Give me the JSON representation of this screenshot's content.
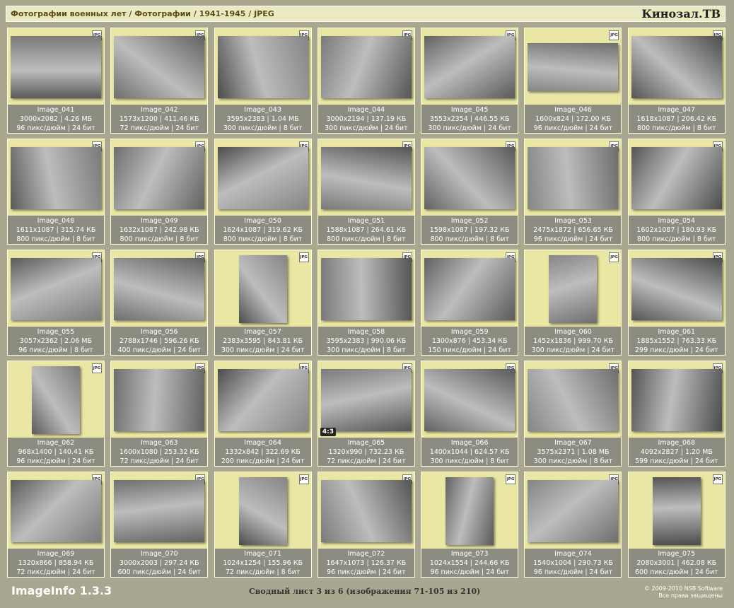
{
  "header": {
    "breadcrumb": "Фотографии военных лет / Фотографии / 1941-1945 / JPEG",
    "site": "Кинозал.ТВ"
  },
  "file_badge": "JPG",
  "images": [
    {
      "name": "Image_041",
      "dims": "3000x2082",
      "size": "4.26 МБ",
      "dpi": "96 пикс/дюйм",
      "bits": "24 бит",
      "orient": "land"
    },
    {
      "name": "Image_042",
      "dims": "1573x1200",
      "size": "411.46 КБ",
      "dpi": "72 пикс/дюйм",
      "bits": "24 бит",
      "orient": "land"
    },
    {
      "name": "Image_043",
      "dims": "3595x2383",
      "size": "1.04 МБ",
      "dpi": "300 пикс/дюйм",
      "bits": "8 бит",
      "orient": "land"
    },
    {
      "name": "Image_044",
      "dims": "3000x2194",
      "size": "137.19 КБ",
      "dpi": "300 пикс/дюйм",
      "bits": "24 бит",
      "orient": "land"
    },
    {
      "name": "Image_045",
      "dims": "3553x2354",
      "size": "446.55 КБ",
      "dpi": "300 пикс/дюйм",
      "bits": "24 бит",
      "orient": "land"
    },
    {
      "name": "Image_046",
      "dims": "1600x824",
      "size": "172.00 КБ",
      "dpi": "96 пикс/дюйм",
      "bits": "24 бит",
      "orient": "wide"
    },
    {
      "name": "Image_047",
      "dims": "1618x1087",
      "size": "206.42 КБ",
      "dpi": "800 пикс/дюйм",
      "bits": "8 бит",
      "orient": "land"
    },
    {
      "name": "Image_048",
      "dims": "1611x1087",
      "size": "315.74 КБ",
      "dpi": "800 пикс/дюйм",
      "bits": "8 бит",
      "orient": "land"
    },
    {
      "name": "Image_049",
      "dims": "1632x1087",
      "size": "242.98 КБ",
      "dpi": "800 пикс/дюйм",
      "bits": "8 бит",
      "orient": "land"
    },
    {
      "name": "Image_050",
      "dims": "1624x1087",
      "size": "319.62 КБ",
      "dpi": "800 пикс/дюйм",
      "bits": "8 бит",
      "orient": "land"
    },
    {
      "name": "Image_051",
      "dims": "1588x1087",
      "size": "264.61 КБ",
      "dpi": "800 пикс/дюйм",
      "bits": "8 бит",
      "orient": "land"
    },
    {
      "name": "Image_052",
      "dims": "1598x1087",
      "size": "197.32 КБ",
      "dpi": "800 пикс/дюйм",
      "bits": "8 бит",
      "orient": "land"
    },
    {
      "name": "Image_053",
      "dims": "2475x1872",
      "size": "656.65 КБ",
      "dpi": "96 пикс/дюйм",
      "bits": "24 бит",
      "orient": "land"
    },
    {
      "name": "Image_054",
      "dims": "1602x1087",
      "size": "180.93 КБ",
      "dpi": "800 пикс/дюйм",
      "bits": "8 бит",
      "orient": "land"
    },
    {
      "name": "Image_055",
      "dims": "3057x2362",
      "size": "2.06 МБ",
      "dpi": "96 пикс/дюйм",
      "bits": "8 бит",
      "orient": "land"
    },
    {
      "name": "Image_056",
      "dims": "2788x1746",
      "size": "596.26 КБ",
      "dpi": "400 пикс/дюйм",
      "bits": "24 бит",
      "orient": "land"
    },
    {
      "name": "Image_057",
      "dims": "2383x3595",
      "size": "843.81 КБ",
      "dpi": "300 пикс/дюйм",
      "bits": "24 бит",
      "orient": "port"
    },
    {
      "name": "Image_058",
      "dims": "3595x2383",
      "size": "990.06 КБ",
      "dpi": "300 пикс/дюйм",
      "bits": "8 бит",
      "orient": "land"
    },
    {
      "name": "Image_059",
      "dims": "1300x876",
      "size": "453.34 КБ",
      "dpi": "150 пикс/дюйм",
      "bits": "24 бит",
      "orient": "land"
    },
    {
      "name": "Image_060",
      "dims": "1452x1836",
      "size": "999.70 КБ",
      "dpi": "300 пикс/дюйм",
      "bits": "24 бит",
      "orient": "port"
    },
    {
      "name": "Image_061",
      "dims": "1885x1552",
      "size": "763.33 КБ",
      "dpi": "299 пикс/дюйм",
      "bits": "24 бит",
      "orient": "land"
    },
    {
      "name": "Image_062",
      "dims": "968x1400",
      "size": "140.41 КБ",
      "dpi": "96 пикс/дюйм",
      "bits": "24 бит",
      "orient": "port"
    },
    {
      "name": "Image_063",
      "dims": "1600x1080",
      "size": "253.32 КБ",
      "dpi": "72 пикс/дюйм",
      "bits": "24 бит",
      "orient": "land"
    },
    {
      "name": "Image_064",
      "dims": "1332x842",
      "size": "322.69 КБ",
      "dpi": "200 пикс/дюйм",
      "bits": "24 бит",
      "orient": "land"
    },
    {
      "name": "Image_065",
      "dims": "1320x990",
      "size": "732.23 КБ",
      "dpi": "72 пикс/дюйм",
      "bits": "24 бит",
      "orient": "land",
      "badge": "4:3"
    },
    {
      "name": "Image_066",
      "dims": "1400x1044",
      "size": "624.57 КБ",
      "dpi": "300 пикс/дюйм",
      "bits": "8 бит",
      "orient": "land"
    },
    {
      "name": "Image_067",
      "dims": "3575x2371",
      "size": "1.08 МБ",
      "dpi": "300 пикс/дюйм",
      "bits": "8 бит",
      "orient": "land"
    },
    {
      "name": "Image_068",
      "dims": "4092x2827",
      "size": "1.20 МБ",
      "dpi": "599 пикс/дюйм",
      "bits": "24 бит",
      "orient": "land"
    },
    {
      "name": "Image_069",
      "dims": "1320x866",
      "size": "858.94 КБ",
      "dpi": "72 пикс/дюйм",
      "bits": "24 бит",
      "orient": "land"
    },
    {
      "name": "Image_070",
      "dims": "3000x2003",
      "size": "297.24 КБ",
      "dpi": "600 пикс/дюйм",
      "bits": "24 бит",
      "orient": "land"
    },
    {
      "name": "Image_071",
      "dims": "1024x1254",
      "size": "155.96 КБ",
      "dpi": "72 пикс/дюйм",
      "bits": "8 бит",
      "orient": "port"
    },
    {
      "name": "Image_072",
      "dims": "1647x1073",
      "size": "126.37 КБ",
      "dpi": "96 пикс/дюйм",
      "bits": "24 бит",
      "orient": "land"
    },
    {
      "name": "Image_073",
      "dims": "1024x1554",
      "size": "244.66 КБ",
      "dpi": "96 пикс/дюйм",
      "bits": "24 бит",
      "orient": "port"
    },
    {
      "name": "Image_074",
      "dims": "1540x1004",
      "size": "290.73 КБ",
      "dpi": "96 пикс/дюйм",
      "bits": "24 бит",
      "orient": "land"
    },
    {
      "name": "Image_075",
      "dims": "2080x3001",
      "size": "462.08 КБ",
      "dpi": "600 пикс/дюйм",
      "bits": "24 бит",
      "orient": "port"
    }
  ],
  "footer": {
    "app": "ImageInfo 1.3.3",
    "sheet": "Сводный лист 3 из 6 (изображения 71-105 из 210)",
    "copyright": "© 2009-2010 NSB Software",
    "rights": "Все права защищены"
  }
}
